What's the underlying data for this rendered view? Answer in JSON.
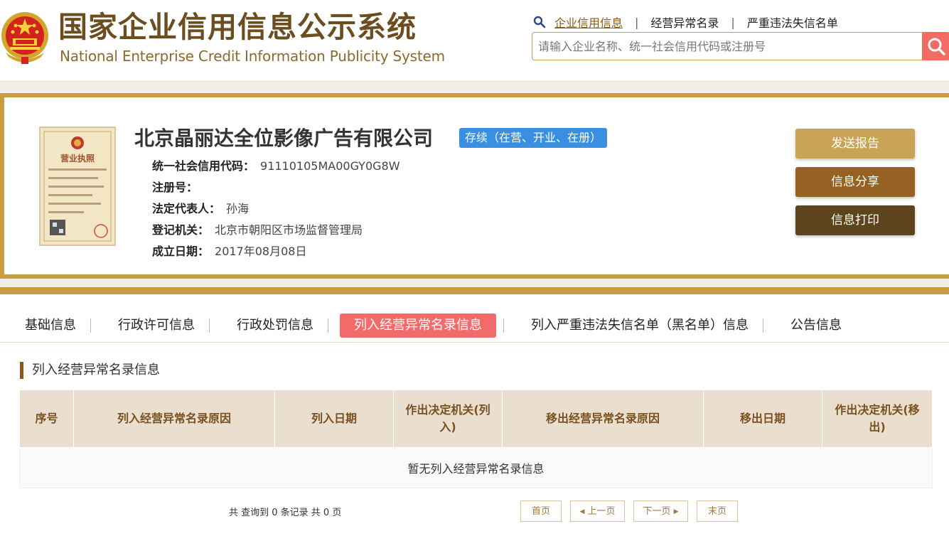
{
  "header": {
    "title_cn": "国家企业信用信息公示系统",
    "title_en": "National Enterprise Credit Information Publicity System",
    "nav": [
      "企业信用信息",
      "经营异常名录",
      "严重违法失信名单"
    ],
    "search_placeholder": "请输入企业名称、统一社会信用代码或注册号"
  },
  "company": {
    "name": "北京晶丽达全位影像广告有限公司",
    "status": "存续（在营、开业、在册）",
    "license_label": "营业执照",
    "fields": [
      {
        "label": "统一社会信用代码：",
        "value": "91110105MA00GY0G8W"
      },
      {
        "label": "注册号：",
        "value": ""
      },
      {
        "label": "法定代表人：",
        "value": "孙海"
      },
      {
        "label": "登记机关：",
        "value": "北京市朝阳区市场监督管理局"
      },
      {
        "label": "成立日期：",
        "value": "2017年08月08日"
      }
    ],
    "actions": [
      "发送报告",
      "信息分享",
      "信息打印"
    ]
  },
  "tabs": [
    "基础信息",
    "行政许可信息",
    "行政处罚信息",
    "列入经营异常名录信息",
    "列入严重违法失信名单（黑名单）信息",
    "公告信息"
  ],
  "section": {
    "title": "列入经营异常名录信息",
    "columns": [
      "序号",
      "列入经营异常名录原因",
      "列入日期",
      "作出决定机关(列入)",
      "移出经营异常名录原因",
      "移出日期",
      "作出决定机关(移出)"
    ],
    "empty_message": "暂无列入经营异常名录信息",
    "total_text": "共 查询到 0 条记录 共 0 页",
    "pager": [
      "首页",
      "上一页",
      "下一页",
      "末页"
    ]
  },
  "colors": {
    "gold": "#c99c3f",
    "brown": "#6b4d1f",
    "active_tab": "#f26b6b",
    "status_blue": "#3b8fe0",
    "search_red": "#f36b62"
  }
}
